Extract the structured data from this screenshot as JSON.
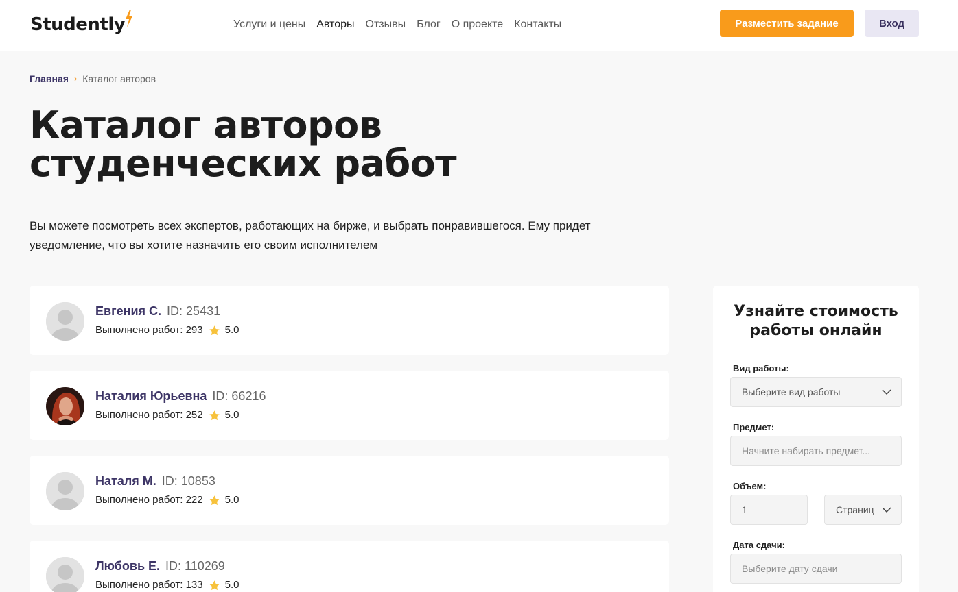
{
  "header": {
    "logo": "Studently",
    "nav": [
      "Услуги и цены",
      "Авторы",
      "Отзывы",
      "Блог",
      "О проекте",
      "Контакты"
    ],
    "order_button": "Разместить задание",
    "login_button": "Вход"
  },
  "breadcrumb": {
    "home": "Главная",
    "separator": "›",
    "current": "Каталог авторов"
  },
  "page": {
    "title": "Каталог авторов студенческих работ",
    "description": "Вы можете посмотреть всех экспертов, работающих на бирже, и выбрать понравившегося. Ему придет уведомление, что вы хотите назначить его своим исполнителем"
  },
  "authors": [
    {
      "name": "Евгения С.",
      "id": "ID: 25431",
      "done": "Выполнено работ: 293",
      "rating": "5.0"
    },
    {
      "name": "Наталия Юрьевна",
      "id": "ID: 66216",
      "done": "Выполнено работ: 252",
      "rating": "5.0"
    },
    {
      "name": "Наталя М.",
      "id": "ID: 10853",
      "done": "Выполнено работ: 222",
      "rating": "5.0"
    },
    {
      "name": "Любовь Е.",
      "id": "ID: 110269",
      "done": "Выполнено работ: 133",
      "rating": "5.0"
    }
  ],
  "sidebar": {
    "title": "Узнайте стоимость работы онлайн",
    "work_type_label": "Вид работы:",
    "work_type_placeholder": "Выберите вид работы",
    "subject_label": "Предмет:",
    "subject_placeholder": "Начните набирать предмет...",
    "volume_label": "Объем:",
    "volume_value": "1",
    "volume_unit": "Страниц",
    "deadline_label": "Дата сдачи:",
    "deadline_placeholder": "Выберите дату сдачи"
  },
  "colors": {
    "accent": "#f99b1b",
    "brand_purple": "#3d3566",
    "star": "#f7c23c"
  }
}
